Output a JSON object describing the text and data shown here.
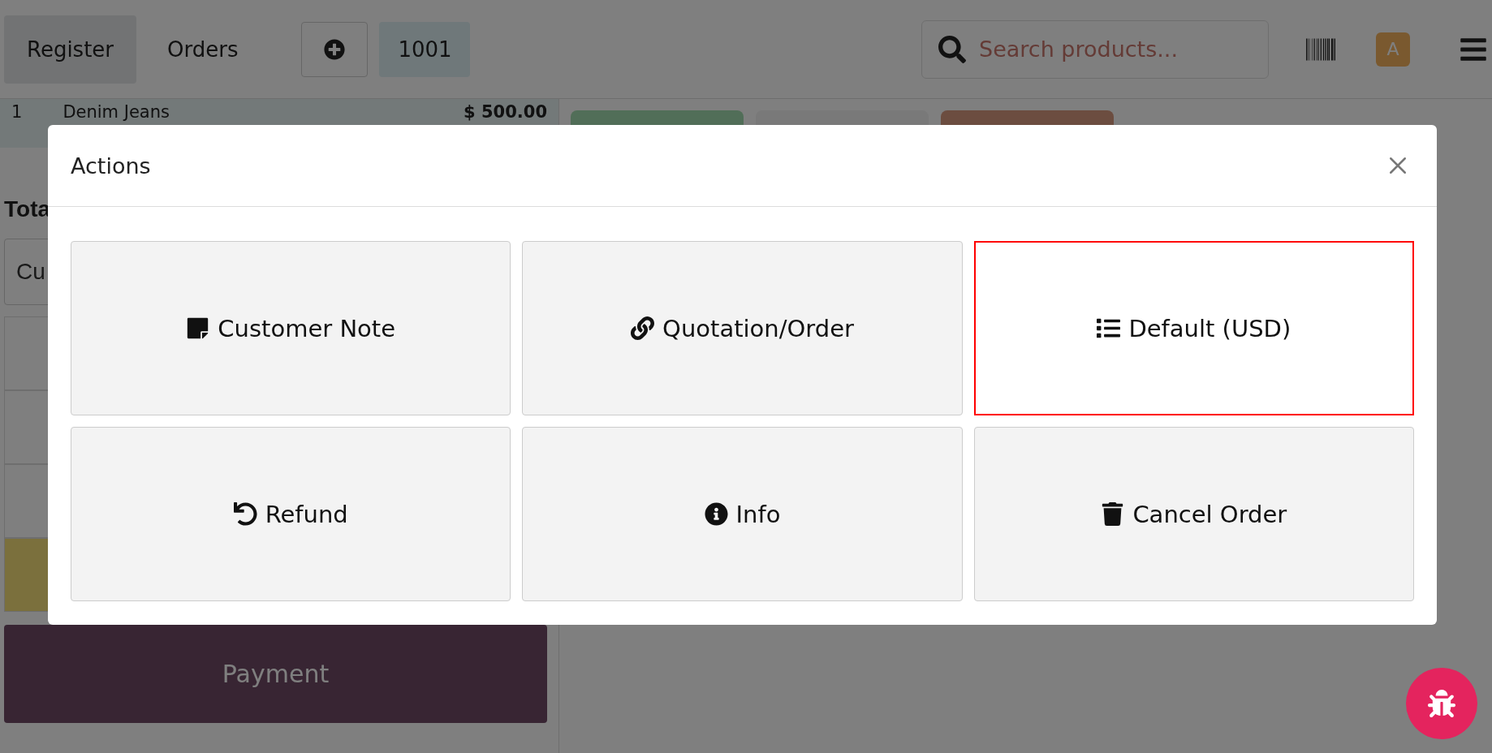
{
  "header": {
    "tabs": [
      {
        "label": "Register",
        "selected": true
      },
      {
        "label": "Orders",
        "selected": false
      }
    ],
    "order_number": "1001",
    "search": {
      "placeholder": "Search products..."
    },
    "avatar": "A"
  },
  "order_lines": [
    {
      "qty": "1",
      "name": "Denim Jeans",
      "price": "$ 500.00",
      "selected": true
    }
  ],
  "totals_label": "Tota",
  "customer_button": "Cu",
  "payment_button": "Payment",
  "modal": {
    "title": "Actions",
    "actions": [
      {
        "kind": "note",
        "label": "Customer Note",
        "selected": false
      },
      {
        "kind": "link",
        "label": "Quotation/Order",
        "selected": false
      },
      {
        "kind": "list",
        "label": "Default (USD)",
        "selected": true
      },
      {
        "kind": "refund",
        "label": "Refund",
        "selected": false
      },
      {
        "kind": "info",
        "label": "Info",
        "selected": false
      },
      {
        "kind": "trash",
        "label": "Cancel Order",
        "selected": false
      }
    ]
  }
}
